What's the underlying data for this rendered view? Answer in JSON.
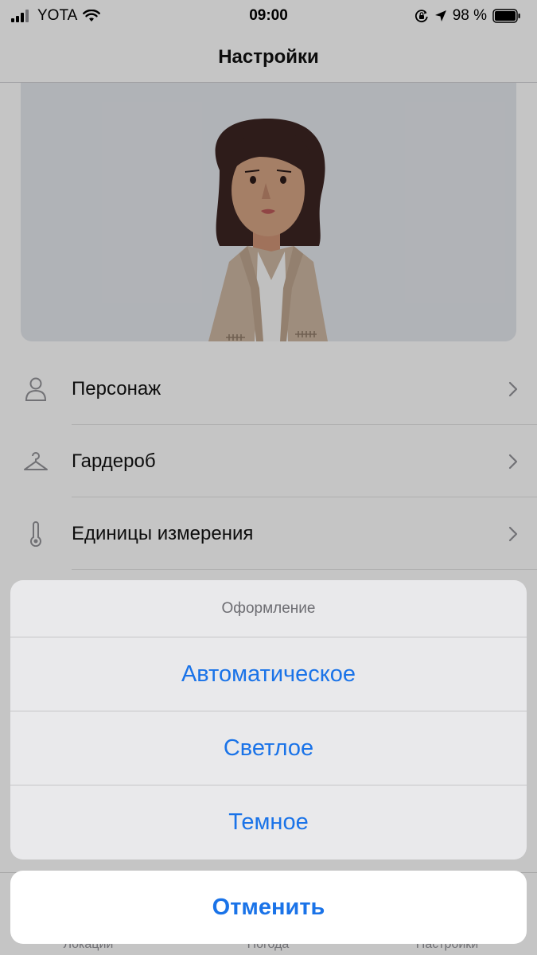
{
  "status_bar": {
    "carrier": "YOTA",
    "time": "09:00",
    "battery": "98 %"
  },
  "nav": {
    "title": "Настройки"
  },
  "settings": {
    "items": [
      {
        "label": "Персонаж",
        "icon": "person-icon"
      },
      {
        "label": "Гардероб",
        "icon": "hanger-icon"
      },
      {
        "label": "Единицы измерения",
        "icon": "thermometer-icon"
      }
    ]
  },
  "tabs": [
    {
      "label": "Локации"
    },
    {
      "label": "Погода"
    },
    {
      "label": "Настройки"
    }
  ],
  "action_sheet": {
    "title": "Оформление",
    "options": [
      {
        "label": "Автоматическое"
      },
      {
        "label": "Светлое"
      },
      {
        "label": "Темное"
      }
    ],
    "cancel": "Отменить"
  },
  "colors": {
    "accent": "#1a73e8",
    "background": "#f7f7f7",
    "avatar_bg": "#dde0e5"
  }
}
